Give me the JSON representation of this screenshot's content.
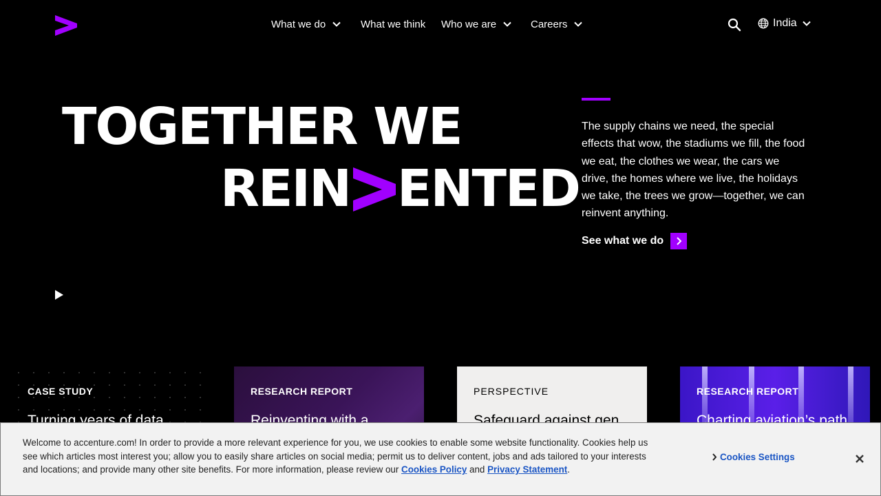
{
  "header": {
    "nav": [
      {
        "label": "What we do",
        "has_dropdown": true
      },
      {
        "label": "What we think",
        "has_dropdown": false
      },
      {
        "label": "Who we are",
        "has_dropdown": true
      },
      {
        "label": "Careers",
        "has_dropdown": true
      }
    ],
    "locale": "India",
    "icons": {
      "logo": "accenture-logo",
      "search": "search-icon",
      "globe": "globe-icon",
      "chevron": "chevron-down-icon"
    }
  },
  "hero": {
    "line1": "TOGETHER WE",
    "line2_start": "REIN",
    "line2_end": "ENTED",
    "body": "The supply chains we need, the special effects that wow, the stadiums we fill, the food we eat, the clothes we wear, the cars we drive, the homes where we live, the holidays we take, the trees we grow—together, we can reinvent anything.",
    "cta_label": "See what we do"
  },
  "cards": [
    {
      "tag": "CASE STUDY",
      "title": "Turning years of data"
    },
    {
      "tag": "RESEARCH REPORT",
      "title": "Reinventing with a"
    },
    {
      "tag": "PERSPECTIVE",
      "title": "Safeguard against gen"
    },
    {
      "tag": "RESEARCH REPORT",
      "title": "Charting aviation’s path"
    }
  ],
  "cookie": {
    "text": "Welcome to accenture.com! In order to provide a more relevant experience for you, we use cookies to enable some website functionality. Cookies help us see which articles most interest you; allow you to easily share articles on social media; permit us to deliver content, jobs and ads tailored to your interests and locations; and provide many other site benefits. For more information, please review our ",
    "policy_link": "Cookies Policy",
    "and": " and ",
    "privacy_link": "Privacy Statement",
    "period": ".",
    "settings_label": "Cookies Settings"
  },
  "colors": {
    "brand": "#a100ff",
    "link": "#1a55c4",
    "banner_bg": "#f2f2f2",
    "page_bg": "#000000"
  }
}
